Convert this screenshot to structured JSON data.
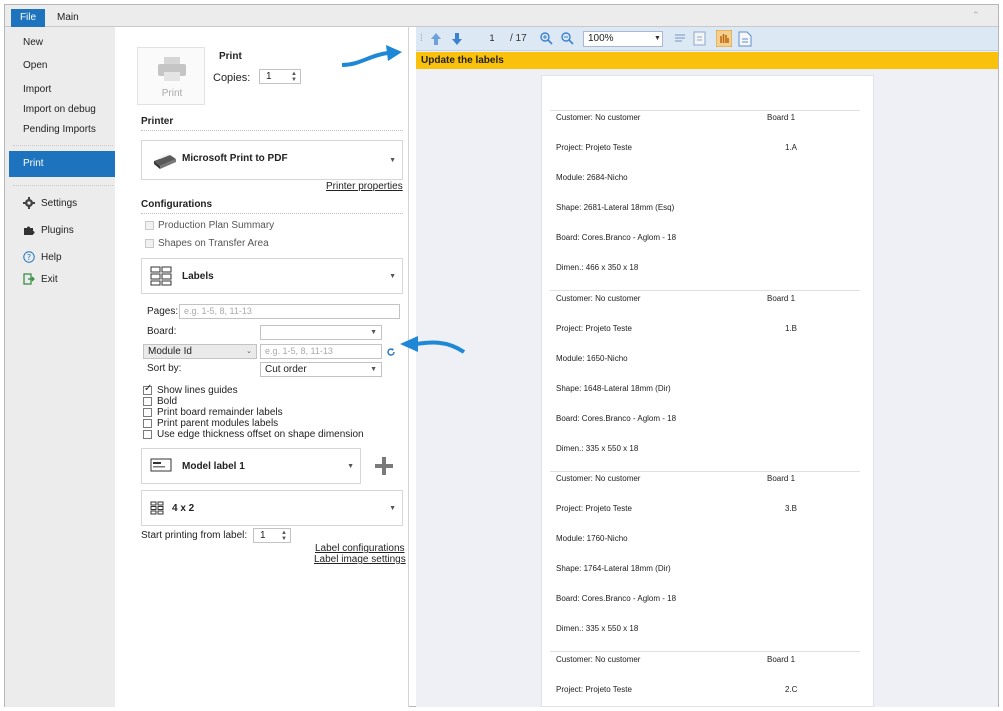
{
  "titlebar": {
    "file_tab": "File",
    "main_tab": "Main"
  },
  "nav": {
    "new": "New",
    "open": "Open",
    "import": "Import",
    "import_debug": "Import on debug",
    "pending": "Pending Imports",
    "print": "Print",
    "settings": "Settings",
    "plugins": "Plugins",
    "help": "Help",
    "exit": "Exit"
  },
  "print_panel": {
    "print_heading": "Print",
    "print_button": "Print",
    "copies_label": "Copies:",
    "copies_value": "1",
    "printer_heading": "Printer",
    "printer_name": "Microsoft Print to PDF",
    "printer_properties": "Printer properties",
    "configurations_heading": "Configurations",
    "production_plan": "Production Plan Summary",
    "shapes_transfer": "Shapes on Transfer Area",
    "labels_combo": "Labels",
    "pages_label": "Pages:",
    "pages_placeholder": "e.g. 1-5, 8, 11-13",
    "board_label": "Board:",
    "board_value": "",
    "module_select": "Module Id",
    "module_placeholder": "e.g. 1-5, 8, 11-13",
    "sort_label": "Sort by:",
    "sort_value": "Cut order",
    "options": [
      {
        "label": "Show lines guides",
        "checked": true
      },
      {
        "label": "Bold",
        "checked": false
      },
      {
        "label": "Print board remainder labels",
        "checked": false
      },
      {
        "label": "Print parent modules labels",
        "checked": false
      },
      {
        "label": "Use edge thickness offset on shape dimension",
        "checked": false
      }
    ],
    "model_label": "Model label 1",
    "layout_label": "4 x 2",
    "start_label": "Start printing from label:",
    "start_value": "1",
    "label_configurations": "Label configurations",
    "label_image_settings": "Label image settings"
  },
  "viewer": {
    "page_current": "1",
    "page_total": "/ 17",
    "zoom": "100%",
    "banner": "Update the labels",
    "labels": [
      {
        "customer": "Customer: No customer",
        "board": "Board 1",
        "project": "Project: Projeto Teste",
        "code": "1.A",
        "module": "Module: 2684-Nicho",
        "shape": "Shape: 2681-Lateral 18mm (Esq)",
        "board_desc": "Board: Cores.Branco - Aglom - 18",
        "dim": "Dimen.: 466 x 350 x 18"
      },
      {
        "customer": "Customer: No customer",
        "board": "Board 1",
        "project": "Project: Projeto Teste",
        "code": "1.B",
        "module": "Module: 1650-Nicho",
        "shape": "Shape: 1648-Lateral 18mm (Dir)",
        "board_desc": "Board: Cores.Branco - Aglom - 18",
        "dim": "Dimen.: 335 x 550 x 18"
      },
      {
        "customer": "Customer: No customer",
        "board": "Board 1",
        "project": "Project: Projeto Teste",
        "code": "3.B",
        "module": "Module: 1760-Nicho",
        "shape": "Shape: 1764-Lateral 18mm (Dir)",
        "board_desc": "Board: Cores.Branco - Aglom - 18",
        "dim": "Dimen.: 335 x 550 x 18"
      },
      {
        "customer": "Customer: No customer",
        "board": "Board 1",
        "project": "Project: Projeto Teste",
        "code": "2.C"
      }
    ]
  },
  "colors": {
    "accent": "#1e73be",
    "banner": "#f9c00c",
    "callout": "#1e88d6"
  }
}
